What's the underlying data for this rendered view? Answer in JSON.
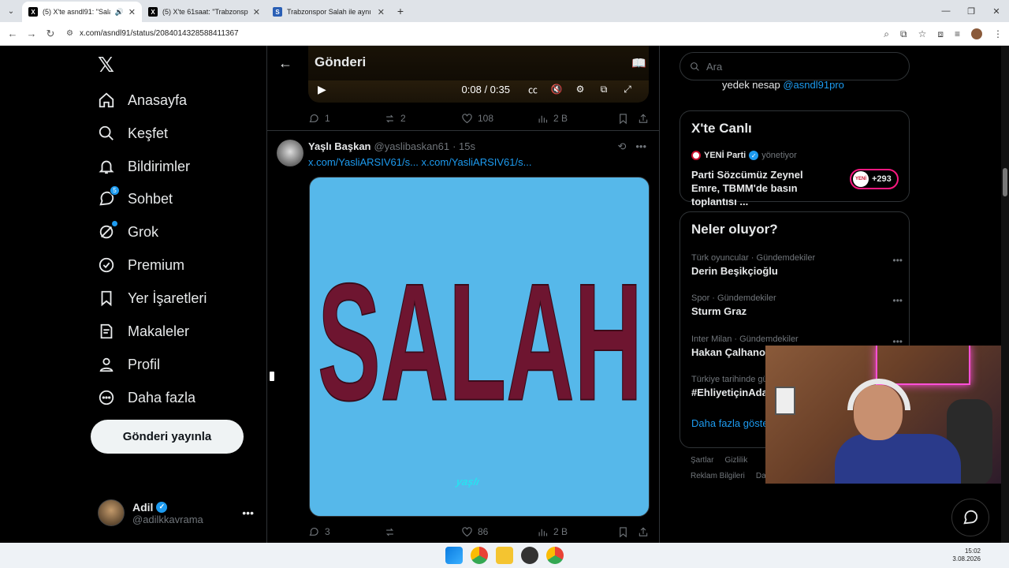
{
  "browser": {
    "tabs": [
      {
        "title": "(5) X'te asndl91: \"Salah gel",
        "active": true,
        "audio": true
      },
      {
        "title": "(5) X'te 61saat: \"Trabzonspor Sa",
        "active": false
      },
      {
        "title": "Trabzonspor Salah ile aynı uçak",
        "active": false
      }
    ],
    "url": "x.com/asndl91/status/2084014328588411367"
  },
  "nav": {
    "items": [
      {
        "label": "Anasayfa",
        "icon": "home-icon"
      },
      {
        "label": "Keşfet",
        "icon": "search-icon"
      },
      {
        "label": "Bildirimler",
        "icon": "bell-icon"
      },
      {
        "label": "Sohbet",
        "icon": "chat-icon",
        "badge": "5"
      },
      {
        "label": "Grok",
        "icon": "grok-icon"
      },
      {
        "label": "Premium",
        "icon": "premium-icon"
      },
      {
        "label": "Yer İşaretleri",
        "icon": "bookmark-icon"
      },
      {
        "label": "Makaleler",
        "icon": "articles-icon"
      },
      {
        "label": "Profil",
        "icon": "profile-icon"
      },
      {
        "label": "Daha fazla",
        "icon": "more-icon"
      }
    ],
    "post_button": "Gönderi yayınla",
    "account": {
      "name": "Adil",
      "handle": "@adilkkavrama"
    }
  },
  "header": {
    "title": "Gönderi"
  },
  "video": {
    "time": "0:08 / 0:35"
  },
  "prev_tweet_actions": {
    "replies": "1",
    "reposts": "2",
    "likes": "108",
    "views": "2 B"
  },
  "tweet": {
    "name": "Yaşlı Başkan",
    "handle": "@yaslibaskan61",
    "age": "· 15s",
    "links": "x.com/YasliARSIV61/s... x.com/YasliARSIV61/s...",
    "media_text": "SALAH",
    "media_mark": "yaşlı",
    "actions": {
      "replies": "3",
      "reposts": "",
      "likes": "86",
      "views": "2 B"
    }
  },
  "right": {
    "search_placeholder": "Ara",
    "prev_tail_text": "yedek nesap",
    "prev_tail_link": "@asndl91pro",
    "live": {
      "title": "X'te Canlı",
      "host": "YENİ Parti",
      "host_role": "yönetiyor",
      "topic": "Parti Sözcümüz Zeynel Emre, TBMM'de basın toplantısı ...",
      "count": "+293"
    },
    "trends_title": "Neler oluyor?",
    "trends": [
      {
        "meta": "Türk oyuncular · Gündemdekiler",
        "name": "Derin Beşikçioğlu"
      },
      {
        "meta": "Spor · Gündemdekiler",
        "name": "Sturm Graz"
      },
      {
        "meta": "Inter Milan · Gündemdekiler",
        "name": "Hakan Çalhanoğ"
      },
      {
        "meta": "Türkiye tarihinde gü",
        "name": "#EhliyetiçinAda"
      }
    ],
    "show_more": "Daha fazla göste",
    "footer": [
      "Şartlar",
      "Gizlilik",
      "Reklam Bilgileri",
      "Da"
    ]
  },
  "clock": {
    "time": "15:02",
    "date": "3.08.2026"
  }
}
